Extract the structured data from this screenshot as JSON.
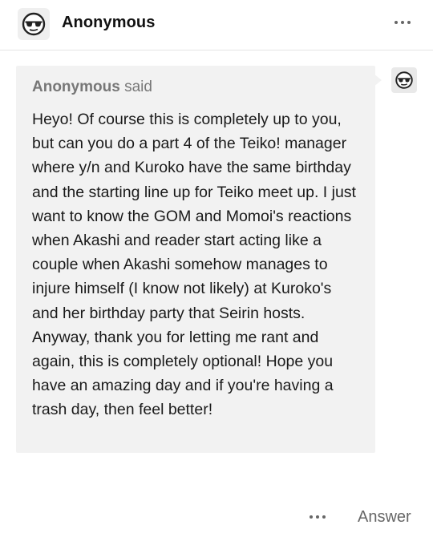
{
  "header": {
    "username": "Anonymous",
    "avatar_icon": "anonymous-sunglasses-icon",
    "more_icon": "more-horizontal-icon"
  },
  "ask": {
    "asker": "Anonymous",
    "said": "said",
    "avatar_icon": "anonymous-sunglasses-icon",
    "question": "Heyo! Of course this is completely up to you, but can you do a part 4 of the Teiko! manager where y/n and Kuroko have the same birthday and the starting line up for Teiko meet up. I just want to know the GOM and Momoi's reactions when Akashi and reader start acting like a couple when Akashi somehow manages to injure himself (I know not likely) at Kuroko's and her birthday party that Seirin hosts. Anyway, thank you for letting me rant and again, this is completely optional! Hope you have an amazing day and if you're having a trash day, then feel better!"
  },
  "footer": {
    "more_icon": "more-horizontal-icon",
    "answer_label": "Answer"
  },
  "colors": {
    "bubble_background": "#f2f2f2",
    "said_text": "#777777",
    "body_text": "#1a1a1a"
  }
}
